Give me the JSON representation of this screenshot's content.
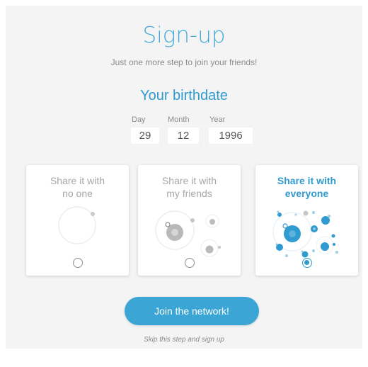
{
  "header": {
    "title": "Sign-up",
    "subtitle": "Just one more step to join your friends!"
  },
  "birthdate": {
    "section_title": "Your birthdate",
    "fields": [
      {
        "label": "Day",
        "value": "29"
      },
      {
        "label": "Month",
        "value": "12"
      },
      {
        "label": "Year",
        "value": "1996"
      }
    ]
  },
  "privacy": {
    "options": [
      {
        "line1": "Share it with",
        "line2": "no one",
        "icon": "no-one-illustration-icon",
        "selected": false
      },
      {
        "line1": "Share it with",
        "line2": "my friends",
        "icon": "friends-illustration-icon",
        "selected": false
      },
      {
        "line1": "Share it with",
        "line2": "everyone",
        "icon": "everyone-illustration-icon",
        "selected": true
      }
    ]
  },
  "actions": {
    "join_label": "Join the network!",
    "skip_label": "Skip this step and sign up"
  },
  "colors": {
    "accent": "#3ba6d6",
    "muted": "#a7a7a7",
    "background": "#f4f4f5"
  }
}
